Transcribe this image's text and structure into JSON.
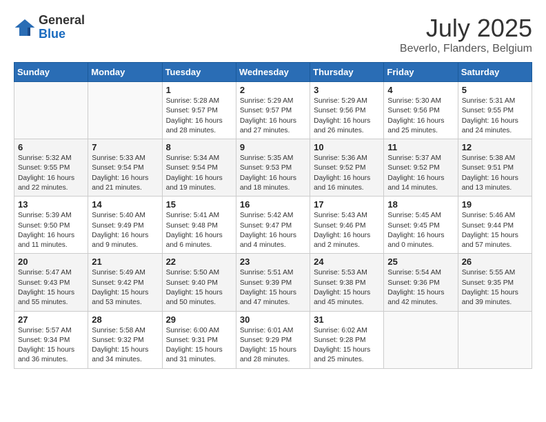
{
  "header": {
    "logo": {
      "general": "General",
      "blue": "Blue"
    },
    "title": "July 2025",
    "subtitle": "Beverlo, Flanders, Belgium"
  },
  "days_of_week": [
    "Sunday",
    "Monday",
    "Tuesday",
    "Wednesday",
    "Thursday",
    "Friday",
    "Saturday"
  ],
  "weeks": [
    {
      "shaded": false,
      "days": [
        {
          "num": "",
          "sunrise": "",
          "sunset": "",
          "daylight": ""
        },
        {
          "num": "",
          "sunrise": "",
          "sunset": "",
          "daylight": ""
        },
        {
          "num": "1",
          "sunrise": "Sunrise: 5:28 AM",
          "sunset": "Sunset: 9:57 PM",
          "daylight": "Daylight: 16 hours and 28 minutes."
        },
        {
          "num": "2",
          "sunrise": "Sunrise: 5:29 AM",
          "sunset": "Sunset: 9:57 PM",
          "daylight": "Daylight: 16 hours and 27 minutes."
        },
        {
          "num": "3",
          "sunrise": "Sunrise: 5:29 AM",
          "sunset": "Sunset: 9:56 PM",
          "daylight": "Daylight: 16 hours and 26 minutes."
        },
        {
          "num": "4",
          "sunrise": "Sunrise: 5:30 AM",
          "sunset": "Sunset: 9:56 PM",
          "daylight": "Daylight: 16 hours and 25 minutes."
        },
        {
          "num": "5",
          "sunrise": "Sunrise: 5:31 AM",
          "sunset": "Sunset: 9:55 PM",
          "daylight": "Daylight: 16 hours and 24 minutes."
        }
      ]
    },
    {
      "shaded": true,
      "days": [
        {
          "num": "6",
          "sunrise": "Sunrise: 5:32 AM",
          "sunset": "Sunset: 9:55 PM",
          "daylight": "Daylight: 16 hours and 22 minutes."
        },
        {
          "num": "7",
          "sunrise": "Sunrise: 5:33 AM",
          "sunset": "Sunset: 9:54 PM",
          "daylight": "Daylight: 16 hours and 21 minutes."
        },
        {
          "num": "8",
          "sunrise": "Sunrise: 5:34 AM",
          "sunset": "Sunset: 9:54 PM",
          "daylight": "Daylight: 16 hours and 19 minutes."
        },
        {
          "num": "9",
          "sunrise": "Sunrise: 5:35 AM",
          "sunset": "Sunset: 9:53 PM",
          "daylight": "Daylight: 16 hours and 18 minutes."
        },
        {
          "num": "10",
          "sunrise": "Sunrise: 5:36 AM",
          "sunset": "Sunset: 9:52 PM",
          "daylight": "Daylight: 16 hours and 16 minutes."
        },
        {
          "num": "11",
          "sunrise": "Sunrise: 5:37 AM",
          "sunset": "Sunset: 9:52 PM",
          "daylight": "Daylight: 16 hours and 14 minutes."
        },
        {
          "num": "12",
          "sunrise": "Sunrise: 5:38 AM",
          "sunset": "Sunset: 9:51 PM",
          "daylight": "Daylight: 16 hours and 13 minutes."
        }
      ]
    },
    {
      "shaded": false,
      "days": [
        {
          "num": "13",
          "sunrise": "Sunrise: 5:39 AM",
          "sunset": "Sunset: 9:50 PM",
          "daylight": "Daylight: 16 hours and 11 minutes."
        },
        {
          "num": "14",
          "sunrise": "Sunrise: 5:40 AM",
          "sunset": "Sunset: 9:49 PM",
          "daylight": "Daylight: 16 hours and 9 minutes."
        },
        {
          "num": "15",
          "sunrise": "Sunrise: 5:41 AM",
          "sunset": "Sunset: 9:48 PM",
          "daylight": "Daylight: 16 hours and 6 minutes."
        },
        {
          "num": "16",
          "sunrise": "Sunrise: 5:42 AM",
          "sunset": "Sunset: 9:47 PM",
          "daylight": "Daylight: 16 hours and 4 minutes."
        },
        {
          "num": "17",
          "sunrise": "Sunrise: 5:43 AM",
          "sunset": "Sunset: 9:46 PM",
          "daylight": "Daylight: 16 hours and 2 minutes."
        },
        {
          "num": "18",
          "sunrise": "Sunrise: 5:45 AM",
          "sunset": "Sunset: 9:45 PM",
          "daylight": "Daylight: 16 hours and 0 minutes."
        },
        {
          "num": "19",
          "sunrise": "Sunrise: 5:46 AM",
          "sunset": "Sunset: 9:44 PM",
          "daylight": "Daylight: 15 hours and 57 minutes."
        }
      ]
    },
    {
      "shaded": true,
      "days": [
        {
          "num": "20",
          "sunrise": "Sunrise: 5:47 AM",
          "sunset": "Sunset: 9:43 PM",
          "daylight": "Daylight: 15 hours and 55 minutes."
        },
        {
          "num": "21",
          "sunrise": "Sunrise: 5:49 AM",
          "sunset": "Sunset: 9:42 PM",
          "daylight": "Daylight: 15 hours and 53 minutes."
        },
        {
          "num": "22",
          "sunrise": "Sunrise: 5:50 AM",
          "sunset": "Sunset: 9:40 PM",
          "daylight": "Daylight: 15 hours and 50 minutes."
        },
        {
          "num": "23",
          "sunrise": "Sunrise: 5:51 AM",
          "sunset": "Sunset: 9:39 PM",
          "daylight": "Daylight: 15 hours and 47 minutes."
        },
        {
          "num": "24",
          "sunrise": "Sunrise: 5:53 AM",
          "sunset": "Sunset: 9:38 PM",
          "daylight": "Daylight: 15 hours and 45 minutes."
        },
        {
          "num": "25",
          "sunrise": "Sunrise: 5:54 AM",
          "sunset": "Sunset: 9:36 PM",
          "daylight": "Daylight: 15 hours and 42 minutes."
        },
        {
          "num": "26",
          "sunrise": "Sunrise: 5:55 AM",
          "sunset": "Sunset: 9:35 PM",
          "daylight": "Daylight: 15 hours and 39 minutes."
        }
      ]
    },
    {
      "shaded": false,
      "days": [
        {
          "num": "27",
          "sunrise": "Sunrise: 5:57 AM",
          "sunset": "Sunset: 9:34 PM",
          "daylight": "Daylight: 15 hours and 36 minutes."
        },
        {
          "num": "28",
          "sunrise": "Sunrise: 5:58 AM",
          "sunset": "Sunset: 9:32 PM",
          "daylight": "Daylight: 15 hours and 34 minutes."
        },
        {
          "num": "29",
          "sunrise": "Sunrise: 6:00 AM",
          "sunset": "Sunset: 9:31 PM",
          "daylight": "Daylight: 15 hours and 31 minutes."
        },
        {
          "num": "30",
          "sunrise": "Sunrise: 6:01 AM",
          "sunset": "Sunset: 9:29 PM",
          "daylight": "Daylight: 15 hours and 28 minutes."
        },
        {
          "num": "31",
          "sunrise": "Sunrise: 6:02 AM",
          "sunset": "Sunset: 9:28 PM",
          "daylight": "Daylight: 15 hours and 25 minutes."
        },
        {
          "num": "",
          "sunrise": "",
          "sunset": "",
          "daylight": ""
        },
        {
          "num": "",
          "sunrise": "",
          "sunset": "",
          "daylight": ""
        }
      ]
    }
  ]
}
